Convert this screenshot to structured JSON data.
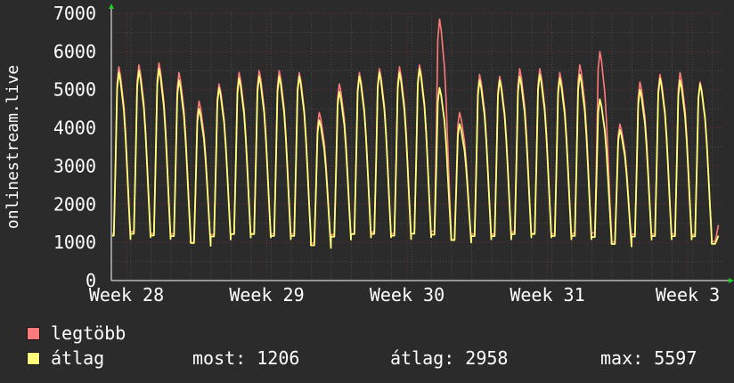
{
  "chart_data": {
    "type": "line",
    "ylabel": "onlinestream.live",
    "ylim": [
      0,
      7000
    ],
    "yticks": [
      0,
      1000,
      2000,
      3000,
      4000,
      5000,
      6000,
      7000
    ],
    "xtick_labels": [
      "Week 28",
      "Week 29",
      "Week 30",
      "Week 31",
      "Week 3"
    ],
    "x_range_days": [
      0,
      35
    ],
    "grid": true,
    "series": [
      {
        "name": "legtöbb",
        "color": "#ff7b7b",
        "daily_peaks": [
          5600,
          5650,
          5700,
          5450,
          4700,
          5150,
          5450,
          5500,
          5500,
          5450,
          4400,
          5150,
          5450,
          5550,
          5600,
          5650,
          6850,
          4400,
          5400,
          5350,
          5550,
          5550,
          5450,
          5650,
          6000,
          4100,
          5200,
          5400,
          5450,
          5200,
          1500
        ],
        "daily_troughs": [
          1000,
          1050,
          1000,
          1000,
          800,
          1000,
          1000,
          1000,
          1000,
          1000,
          800,
          1000,
          1000,
          1050,
          1000,
          1000,
          1000,
          900,
          1000,
          1000,
          1050,
          1000,
          1000,
          1000,
          1000,
          850,
          1000,
          1000,
          1000,
          1000,
          1000
        ]
      },
      {
        "name": "átlag",
        "color": "#ffff7b",
        "daily_peaks": [
          5450,
          5500,
          5550,
          5250,
          4500,
          5050,
          5300,
          5350,
          5350,
          5350,
          4200,
          4950,
          5350,
          5450,
          5450,
          5550,
          5050,
          4100,
          5250,
          5250,
          5350,
          5400,
          5300,
          5400,
          4750,
          3950,
          5000,
          5300,
          5250,
          5150,
          1200
        ],
        "daily_troughs": [
          950,
          1000,
          950,
          950,
          800,
          950,
          1000,
          1000,
          950,
          950,
          750,
          950,
          1000,
          1000,
          950,
          1000,
          1000,
          900,
          950,
          950,
          1000,
          1000,
          950,
          950,
          950,
          800,
          950,
          950,
          950,
          950,
          950
        ]
      }
    ]
  },
  "legend": [
    {
      "label": "legtöbb",
      "color": "#ff7b7b"
    },
    {
      "label": "átlag",
      "color": "#ffff7b"
    }
  ],
  "stats": {
    "most": "most: 1206",
    "atlag": "átlag: 2958",
    "max": "max: 5597"
  }
}
